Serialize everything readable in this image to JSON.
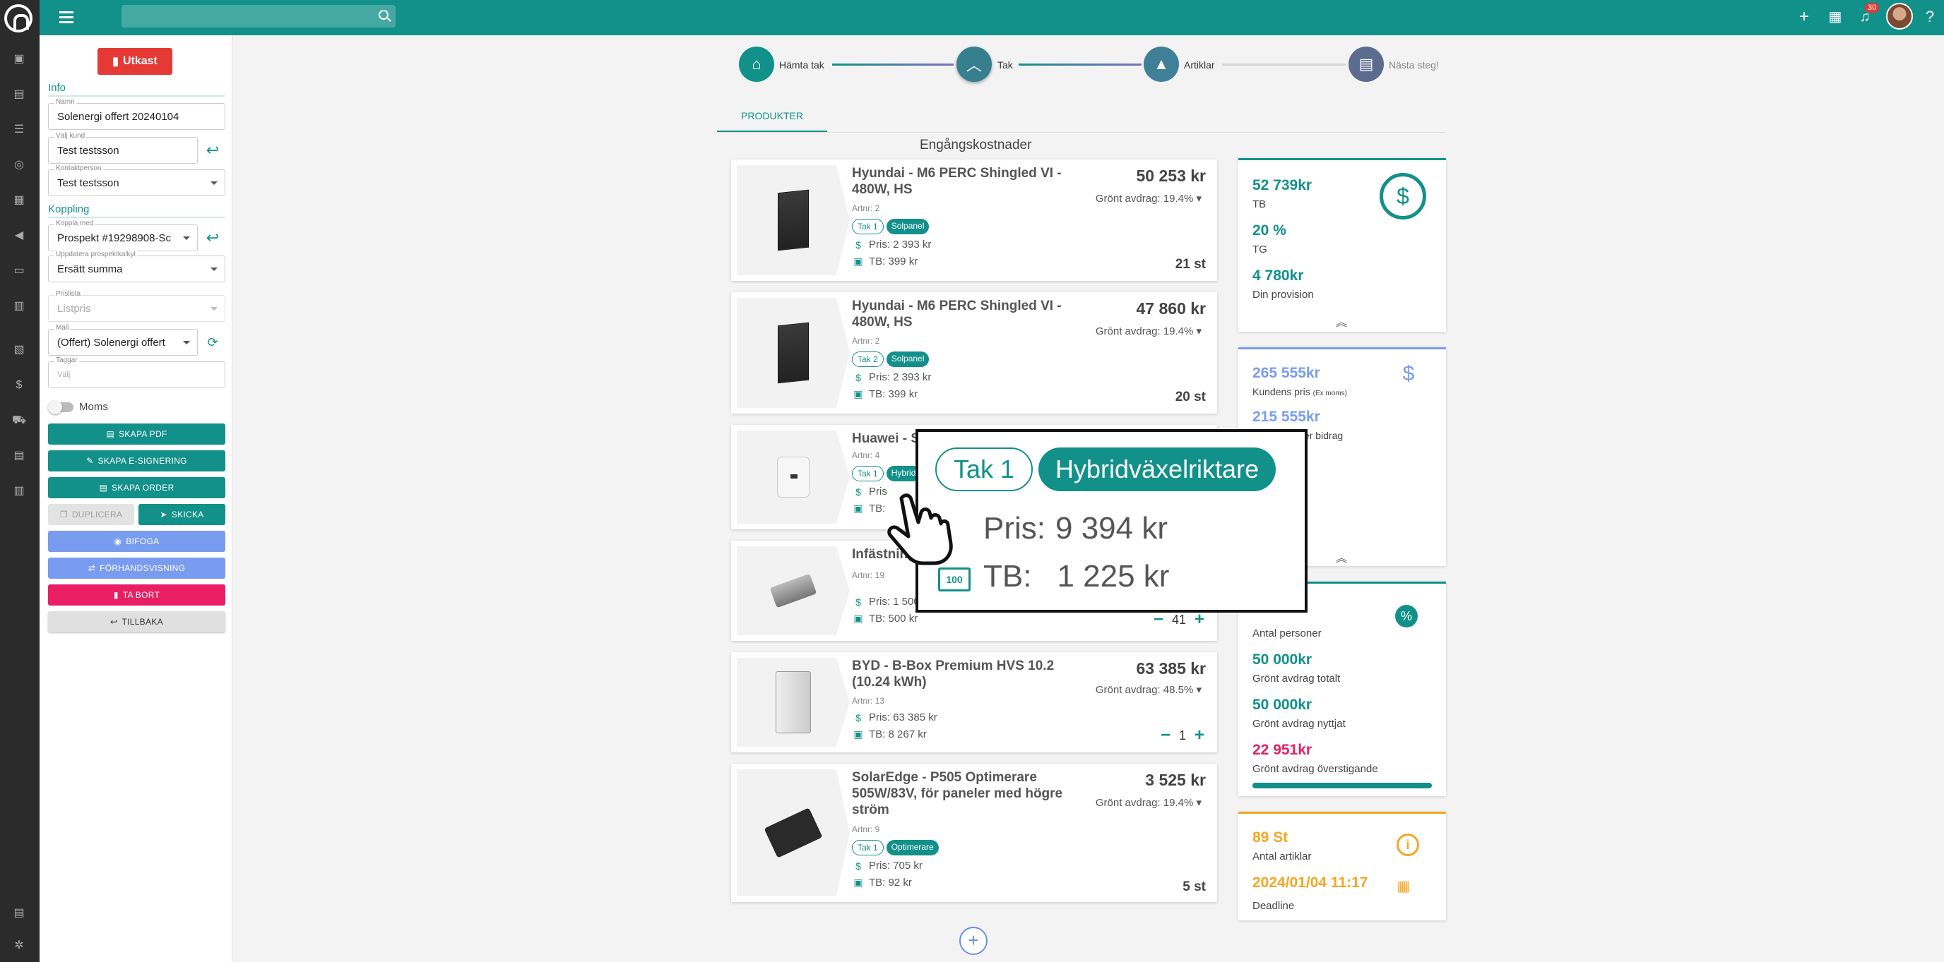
{
  "topbar": {
    "notification_count": "30",
    "icons": [
      "menu-icon",
      "search-icon",
      "plus-icon",
      "calendar-icon",
      "bell-icon",
      "help-icon"
    ]
  },
  "rail_icons": [
    "home-icon",
    "document-icon",
    "table-icon",
    "headset-icon",
    "list-icon",
    "megaphone-icon",
    "inbox-icon",
    "calendar-icon",
    "files-icon",
    "dollar-icon",
    "cart-icon",
    "report-icon",
    "pdf-icon",
    "doc-icon",
    "settings-icon"
  ],
  "panel": {
    "status_button": "Utkast",
    "info_title": "Info",
    "name": {
      "label": "Namn",
      "value": "Solenergi offert 20240104"
    },
    "customer": {
      "label": "Välj kund",
      "value": "Test testsson"
    },
    "contact": {
      "label": "Kontaktperson",
      "value": "Test testsson"
    },
    "link_title": "Koppling",
    "link_with": {
      "label": "Koppla med",
      "value": "Prospekt #19298908-Sc"
    },
    "update_prospect": {
      "label": "Uppdatera prospektkalkyl",
      "value": "Ersätt summa"
    },
    "pricelist": {
      "label": "Prislista",
      "value": "Listpris"
    },
    "template": {
      "label": "Mall",
      "value": "(Offert) Solenergi offert"
    },
    "tags": {
      "label": "Taggar",
      "placeholder": "Välj"
    },
    "vat_label": "Moms",
    "buttons": {
      "pdf": "SKAPA PDF",
      "esign": "SKAPA E-SIGNERING",
      "order": "SKAPA ORDER",
      "duplicate": "DUPLICERA",
      "send": "SKICKA",
      "attach": "BIFOGA",
      "preview": "FÖRHANDSVISNING",
      "delete": "TA BORT",
      "back": "TILLBAKA"
    }
  },
  "stepper": {
    "steps": [
      {
        "label": "Hämta tak"
      },
      {
        "label": "Tak"
      },
      {
        "label": "Artiklar"
      },
      {
        "label": "Nästa steg!"
      }
    ]
  },
  "tab": "PRODUKTER",
  "section_heading": "Engångskostnader",
  "products": [
    {
      "name": "Hyundai - M6 PERC Shingled VI - 480W, HS",
      "artnr": "Artnr: 2",
      "tags": [
        "Tak 1",
        "Solpanel"
      ],
      "pris": "Pris: 2 393 kr",
      "tb": "TB:   399 kr",
      "total": "50 253 kr",
      "green": "Grönt avdrag: 19.4%",
      "qty": "21 st"
    },
    {
      "name": "Hyundai - M6 PERC Shingled VI - 480W, HS",
      "artnr": "Artnr: 2",
      "tags": [
        "Tak 2",
        "Solpanel"
      ],
      "pris": "Pris: 2 393 kr",
      "tb": "TB:   399 kr",
      "total": "47 860 kr",
      "green": "Grönt avdrag: 19.4%",
      "qty": "20 st"
    },
    {
      "name": "Huawei - S",
      "artnr": "Artnr: 4",
      "tags": [
        "Tak 1",
        "Hybrid"
      ],
      "pris": "Pris",
      "tb": "TB:"
    },
    {
      "name": "Infästning",
      "artnr": "Artnr: 19",
      "pris": "Pris: 1 500",
      "tb": "TB:   500 kr",
      "qty_value": "41"
    },
    {
      "name": "BYD - B-Box Premium HVS 10.2 (10.24 kWh)",
      "artnr": "Artnr: 13",
      "pris": "Pris: 63 385  kr",
      "tb": "TB:   8 267 kr",
      "total": "63 385 kr",
      "green": "Grönt avdrag: 48.5%",
      "qty_value": "1"
    },
    {
      "name": "SolarEdge - P505 Optimerare 505W/83V, för paneler med högre ström",
      "artnr": "Artnr: 9",
      "tags": [
        "Tak 1",
        "Optimerare"
      ],
      "pris": "Pris: 705 kr",
      "tb": "TB:   92 kr",
      "total": "3 525 kr",
      "green": "Grönt avdrag: 19.4%",
      "qty": "5 st"
    }
  ],
  "kpi": {
    "tb_value": "52 739kr",
    "tb_label": "TB",
    "tg_value": "20 %",
    "tg_label": "TG",
    "prov_value": "4 780kr",
    "prov_label": "Din provision",
    "customer_price_value": "265 555kr",
    "customer_price_label": "Kundens pris",
    "customer_price_note": "(Ex moms)",
    "after_value": "215 555kr",
    "after_label": "s pris efter bidrag",
    "persons_label": "Antal personer",
    "green_total_value": "50 000kr",
    "green_total_label": "Grönt avdrag totalt",
    "green_used_value": "50 000kr",
    "green_used_label": "Grönt avdrag nyttjat",
    "green_over_value": "22 951kr",
    "green_over_label": "Grönt avdrag överstigande",
    "green_progress": 1.0,
    "articles_value": "89 St",
    "articles_label": "Antal artiklar",
    "deadline_value": "2024/01/04 11:17",
    "deadline_label": "Deadline"
  },
  "zoom": {
    "tag1": "Tak 1",
    "tag2": "Hybridväxelriktare",
    "pris_label": "Pris:",
    "pris_value": "9 394 kr",
    "tb_label": "TB:",
    "tb_value": "1 225 kr",
    "tb_icon_text": "100"
  },
  "colors": {
    "primary": "#12908a",
    "danger": "#e53935",
    "pink": "#e91e63",
    "blue": "#7a9cf0",
    "orange": "#f5a623"
  }
}
